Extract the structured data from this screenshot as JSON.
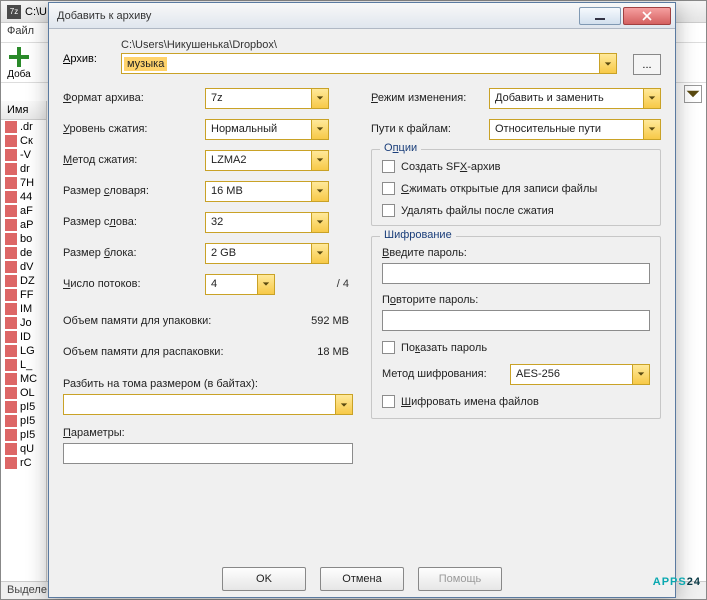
{
  "bg": {
    "titlePrefix": "C:\\U",
    "menuFile": "Файл",
    "addLabel": "Доба",
    "nameHeader": "Имя",
    "rows": [
      ".dr",
      "Ск",
      "-V",
      "dr",
      "7H",
      "44",
      "aF",
      "aP",
      "bo",
      "de",
      "dV",
      "DZ",
      "FF",
      "IM",
      "Jo",
      "ID",
      "LG",
      "L_",
      "MC",
      "OL",
      "pI5",
      "pI5",
      "pI5",
      "qU",
      "rC"
    ],
    "status": "Выделе"
  },
  "dialog": {
    "title": "Добавить к архиву",
    "archiveLabel": "Архив:",
    "archivePath": "C:\\Users\\Никушенька\\Dropbox\\",
    "archiveName": "музыка",
    "browse": "...",
    "left": {
      "formatLabel": "Формат архива:",
      "formatValue": "7z",
      "levelLabel": "Уровень сжатия:",
      "levelValue": "Нормальный",
      "methodLabel": "Метод сжатия:",
      "methodValue": "LZMA2",
      "dictLabel": "Размер словаря:",
      "dictValue": "16 MB",
      "wordLabel": "Размер слова:",
      "wordValue": "32",
      "blockLabel": "Размер блока:",
      "blockValue": "2 GB",
      "threadsLabel": "Число потоков:",
      "threadsValue": "4",
      "threadsMax": "/ 4",
      "memPackLabel": "Объем памяти для упаковки:",
      "memPackValue": "592 MB",
      "memUnpackLabel": "Объем памяти для распаковки:",
      "memUnpackValue": "18 MB",
      "splitLabel": "Разбить на тома размером (в байтах):",
      "paramsLabel": "Параметры:"
    },
    "right": {
      "modeLabel": "Режим изменения:",
      "modeValue": "Добавить и заменить",
      "pathsLabel": "Пути к файлам:",
      "pathsValue": "Относительные пути",
      "optionsTitle": "Опции",
      "sfx": "Создать SFX-архив",
      "compressOpen": "Сжимать открытые для записи файлы",
      "deleteAfter": "Удалять файлы после сжатия",
      "encTitle": "Шифрование",
      "pwdLabel": "Введите пароль:",
      "pwd2Label": "Повторите пароль:",
      "showPwd": "Показать пароль",
      "encMethodLabel": "Метод шифрования:",
      "encMethodValue": "AES-256",
      "encNames": "Шифровать имена файлов"
    },
    "buttons": {
      "ok": "OK",
      "cancel": "Отмена",
      "help": "Помощь"
    }
  },
  "watermark": {
    "a": "APPS",
    "b": "24"
  }
}
